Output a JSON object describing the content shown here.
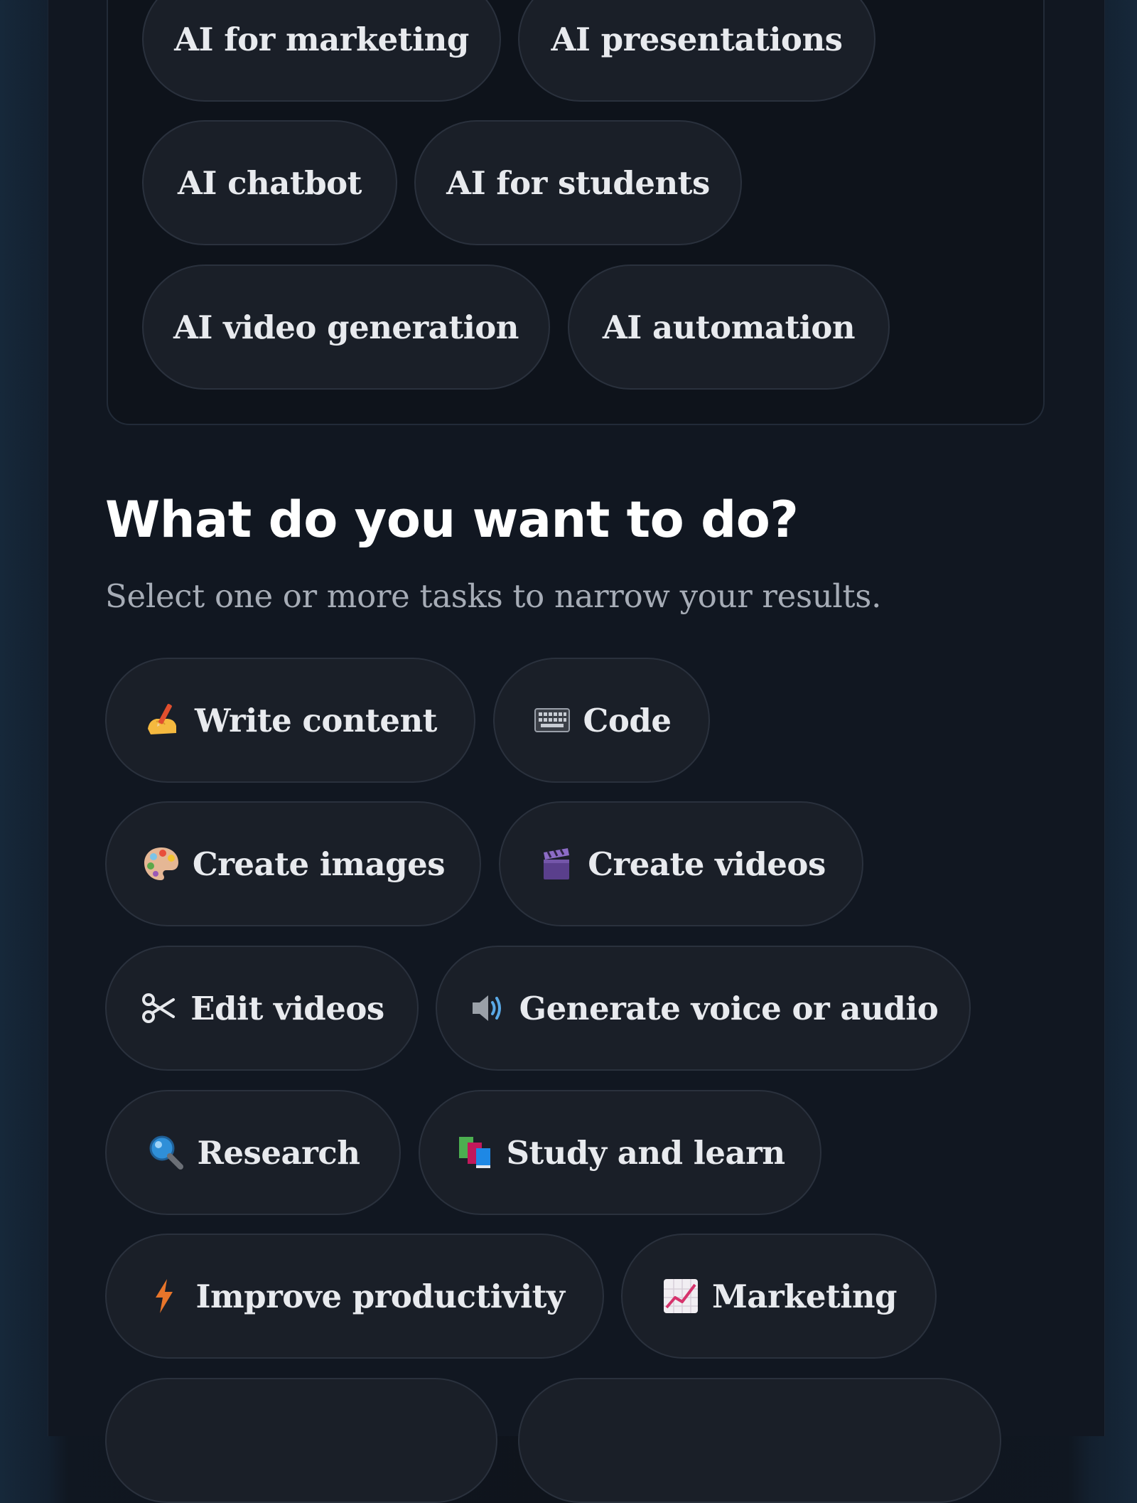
{
  "topics": {
    "items": [
      "AI for marketing",
      "AI presentations",
      "AI chatbot",
      "AI for students",
      "AI video generation",
      "AI automation"
    ]
  },
  "tasks_section": {
    "title": "What do you want to do?",
    "subtitle": "Select one or more tasks to narrow your results.",
    "items": [
      {
        "label": "Write content",
        "icon": "writing-hand-icon"
      },
      {
        "label": "Code",
        "icon": "keyboard-icon"
      },
      {
        "label": "Create images",
        "icon": "palette-icon"
      },
      {
        "label": "Create videos",
        "icon": "clapper-board-icon"
      },
      {
        "label": "Edit videos",
        "icon": "scissors-icon"
      },
      {
        "label": "Generate voice or audio",
        "icon": "speaker-icon"
      },
      {
        "label": "Research",
        "icon": "magnifying-glass-icon"
      },
      {
        "label": "Study and learn",
        "icon": "books-icon"
      },
      {
        "label": "Improve productivity",
        "icon": "lightning-icon"
      },
      {
        "label": "Marketing",
        "icon": "chart-increasing-icon"
      }
    ]
  }
}
